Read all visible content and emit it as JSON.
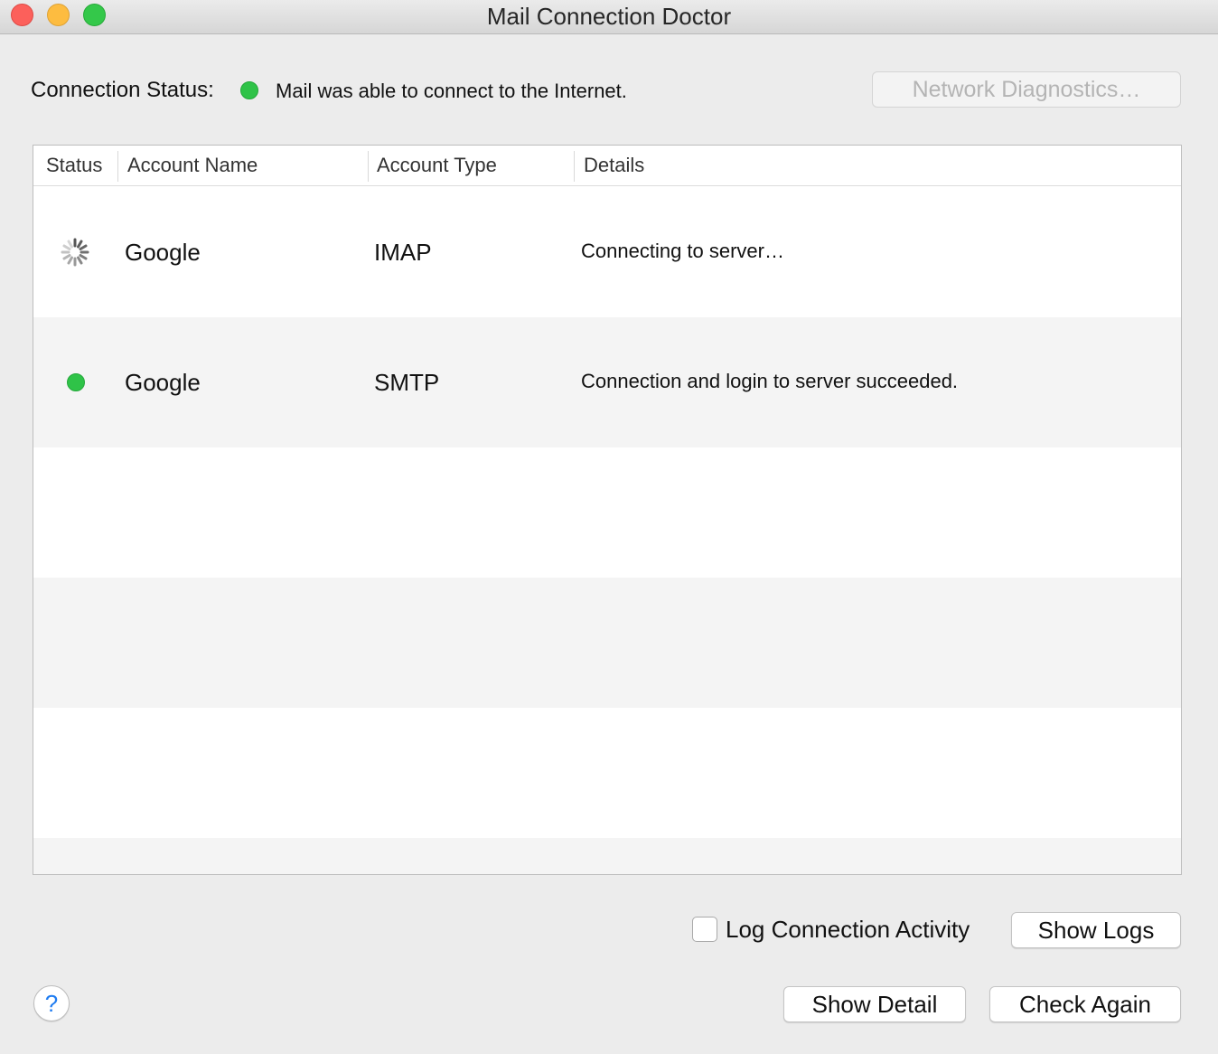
{
  "window": {
    "title": "Mail Connection Doctor"
  },
  "connection": {
    "label": "Connection Status:",
    "message": "Mail was able to connect to the Internet.",
    "status_color": "#2fc348"
  },
  "buttons": {
    "network_diagnostics": "Network Diagnostics…",
    "show_logs": "Show Logs",
    "show_detail": "Show Detail",
    "check_again": "Check Again",
    "help": "?"
  },
  "table": {
    "columns": [
      "Status",
      "Account Name",
      "Account Type",
      "Details"
    ],
    "rows": [
      {
        "status": "spinner-icon",
        "name": "Google",
        "type": "IMAP",
        "details": "Connecting to server…"
      },
      {
        "status": "green-status-dot",
        "name": "Google",
        "type": "SMTP",
        "details": "Connection and login to server succeeded."
      }
    ]
  },
  "options": {
    "log_connection_activity": "Log Connection Activity",
    "log_connection_activity_checked": false
  }
}
